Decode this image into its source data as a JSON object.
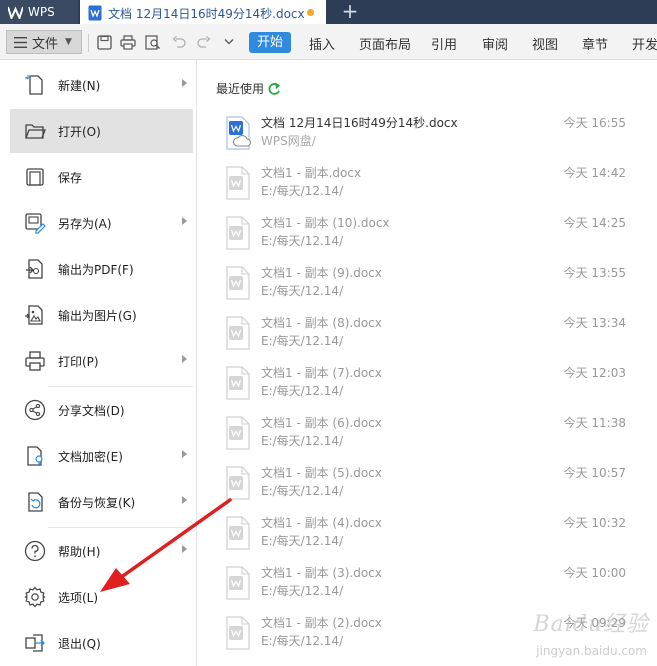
{
  "titlebar": {
    "app_tab": "WPS",
    "doc_tab": "文档 12月14日16时49分14秒.docx",
    "add_tab": "+"
  },
  "ribbon": {
    "file_label": "文件",
    "tabs": [
      "开始",
      "插入",
      "页面布局",
      "引用",
      "审阅",
      "视图",
      "章节",
      "开发"
    ],
    "active_tab": "开始"
  },
  "menu": {
    "items": [
      {
        "label": "新建(N)",
        "icon": "new-doc-icon",
        "submenu": true
      },
      {
        "label": "打开(O)",
        "icon": "folder-open-icon",
        "submenu": false,
        "active": true
      },
      {
        "label": "保存",
        "icon": "save-icon",
        "submenu": false
      },
      {
        "label": "另存为(A)",
        "icon": "save-as-icon",
        "submenu": true
      },
      {
        "label": "输出为PDF(F)",
        "icon": "pdf-export-icon",
        "submenu": false
      },
      {
        "label": "输出为图片(G)",
        "icon": "image-export-icon",
        "submenu": false
      },
      {
        "label": "打印(P)",
        "icon": "printer-icon",
        "submenu": true
      },
      {
        "label": "分享文档(D)",
        "icon": "share-icon",
        "submenu": false
      },
      {
        "label": "文档加密(E)",
        "icon": "encrypt-icon",
        "submenu": true
      },
      {
        "label": "备份与恢复(K)",
        "icon": "backup-icon",
        "submenu": true
      },
      {
        "label": "帮助(H)",
        "icon": "help-icon",
        "submenu": true
      },
      {
        "label": "选项(L)",
        "icon": "gear-icon",
        "submenu": false
      },
      {
        "label": "退出(Q)",
        "icon": "exit-icon",
        "submenu": false
      }
    ]
  },
  "recent": {
    "header": "最近使用",
    "files": [
      {
        "name": "文档 12月14日16时49分14秒.docx",
        "path": "WPS网盘/",
        "time": "今天 16:55"
      },
      {
        "name": "文档1 - 副本.docx",
        "path": "E:/每天/12.14/",
        "time": "今天 14:42"
      },
      {
        "name": "文档1 - 副本 (10).docx",
        "path": "E:/每天/12.14/",
        "time": "今天 14:25"
      },
      {
        "name": "文档1 - 副本 (9).docx",
        "path": "E:/每天/12.14/",
        "time": "今天 13:55"
      },
      {
        "name": "文档1 - 副本 (8).docx",
        "path": "E:/每天/12.14/",
        "time": "今天 13:34"
      },
      {
        "name": "文档1 - 副本 (7).docx",
        "path": "E:/每天/12.14/",
        "time": "今天 12:03"
      },
      {
        "name": "文档1 - 副本 (6).docx",
        "path": "E:/每天/12.14/",
        "time": "今天 11:38"
      },
      {
        "name": "文档1 - 副本 (5).docx",
        "path": "E:/每天/12.14/",
        "time": "今天 10:57"
      },
      {
        "name": "文档1 - 副本 (4).docx",
        "path": "E:/每天/12.14/",
        "time": "今天 10:32"
      },
      {
        "name": "文档1 - 副本 (3).docx",
        "path": "E:/每天/12.14/",
        "time": "今天 10:00"
      },
      {
        "name": "文档1 - 副本 (2).docx",
        "path": "E:/每天/12.14/",
        "time": "今天 09:29"
      }
    ]
  },
  "colors": {
    "titlebar_bg": "#2e3d55",
    "accent": "#2f8be0",
    "annotation_arrow": "#e02020"
  },
  "watermark": {
    "text": "Baidu经验",
    "url": "jingyan.baidu.com"
  }
}
